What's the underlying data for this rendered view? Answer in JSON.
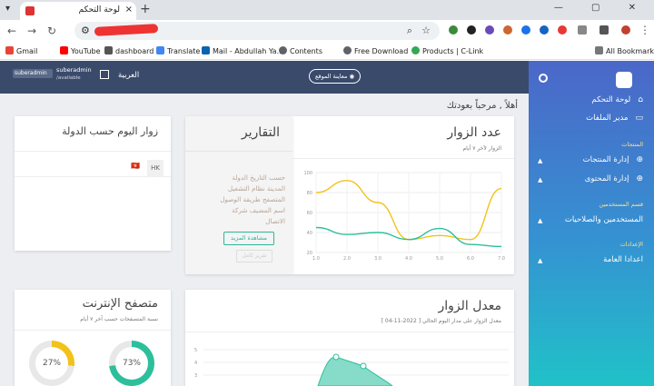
{
  "browser": {
    "tab_title": "لوحة التحكم",
    "tab_close": "×",
    "new_tab": "+",
    "window_controls": "— ▢ ✕",
    "nav": {
      "back": "←",
      "forward": "→",
      "reload": "↻"
    },
    "bookmarks": [
      "Gmail",
      "YouTube",
      "dashboard",
      "Translate",
      "Mail - Abdullah Ya...",
      "Contents",
      "Free Download",
      "Products | C-Link"
    ],
    "all_bookmarks": "All Bookmarks",
    "colors": {
      "gmail": "#ea4335",
      "youtube": "#ff0000",
      "dashboard": "#555555",
      "translate": "#4285f4",
      "mail": "#0a64ad",
      "contents": "#5f6368",
      "free": "#5f6368",
      "clink": "#34a853"
    }
  },
  "topbar": {
    "user_name": "suberadmin",
    "user_status": "/available",
    "logo_text": "suberadmin",
    "language": "العربية",
    "preview_button": "معاينة الموقع"
  },
  "sidebar": {
    "items": [
      {
        "label": "لوحة التحكم",
        "icon": "home-icon"
      },
      {
        "label": "مدير الملفات",
        "icon": "folder-icon"
      }
    ],
    "sections": [
      {
        "title": "المنتجات",
        "items": [
          "إدارة المنتجات",
          "إدارة المحتوى"
        ]
      },
      {
        "title": "قسم المستخدمين",
        "items": [
          "المستخدمين والصلاحيات"
        ]
      },
      {
        "title": "الإعدادات",
        "items": [
          "اعدادا العامة"
        ]
      }
    ]
  },
  "welcome": "أهلاً , مرحباً بعودتك",
  "visitors": {
    "title": "عدد الزوار",
    "subtitle": "الزوار لآخر ٧ أيام",
    "colors": {
      "a": "#f2c21b",
      "b": "#2dbf9c"
    }
  },
  "chart_data": {
    "type": "line",
    "x": [
      1.0,
      2.0,
      3.0,
      4.0,
      5.0,
      6.0,
      7.0
    ],
    "x_ticks": [
      "1.0",
      "2.0",
      "3.0",
      "4.0",
      "5.0",
      "6.0",
      "7.0"
    ],
    "y_ticks": [
      "20",
      "40",
      "60",
      "80",
      "100"
    ],
    "ylim": [
      20,
      100
    ],
    "series": [
      {
        "values": [
          80,
          92,
          70,
          33,
          37,
          33,
          84
        ],
        "color": "#f2c21b"
      },
      {
        "values": [
          45,
          38,
          40,
          33,
          44,
          28,
          26
        ],
        "color": "#2dbf9c"
      }
    ]
  },
  "reports": {
    "title": "التقارير",
    "links": [
      "حسب التاريخ",
      "الدولة",
      "المدينة",
      "نظام التشغيل",
      "المتصفح",
      "طريقة الوصول",
      "اسم المضيف",
      "شركة الاتصال"
    ],
    "more_button": "مشاهدة المزيد",
    "ghost_button": "تقرير كامل"
  },
  "country": {
    "title": "زوار اليوم حسب الدولة",
    "code": "HK",
    "flag": "🇭🇰"
  },
  "rate": {
    "title": "معدل الزوار",
    "subtitle": "معدل الزوار على مدار اليوم الحالي [ 2022-11-04 ]",
    "y_ticks": [
      "5",
      "4",
      "3"
    ]
  },
  "browsers": {
    "title": "متصفح الإنترنت",
    "subtitle": "نسبة المتصفحات حسب آخر ٧ أيام",
    "donuts": [
      {
        "value": "27%",
        "fraction": 0.27,
        "color": "#f2c21b"
      },
      {
        "value": "73%",
        "fraction": 0.73,
        "color": "#2dbf9c"
      }
    ]
  }
}
